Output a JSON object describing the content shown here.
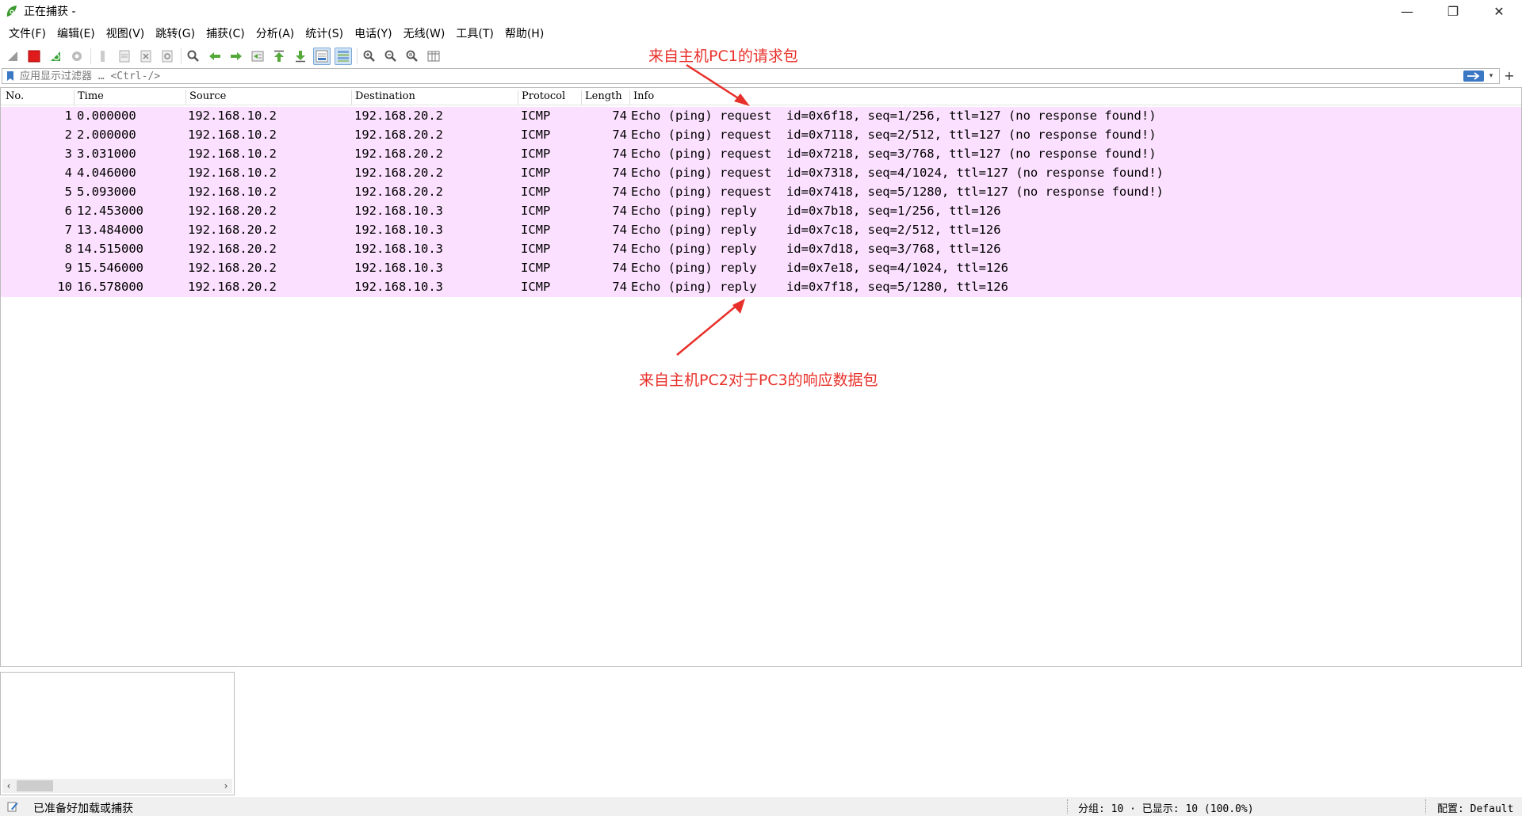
{
  "window": {
    "title": "正在捕获 -",
    "minimize": "—",
    "restore": "❐",
    "close": "✕"
  },
  "menu": [
    "文件(F)",
    "编辑(E)",
    "视图(V)",
    "跳转(G)",
    "捕获(C)",
    "分析(A)",
    "统计(S)",
    "电话(Y)",
    "无线(W)",
    "工具(T)",
    "帮助(H)"
  ],
  "toolbar": {
    "icons": [
      "start-capture-icon",
      "stop-capture-icon",
      "restart-capture-icon",
      "capture-options-icon",
      "open-file-icon",
      "save-file-icon",
      "close-file-icon",
      "reload-file-icon",
      "find-packet-icon",
      "go-back-icon",
      "go-forward-icon",
      "go-to-packet-icon",
      "go-first-icon",
      "go-last-icon",
      "auto-scroll-icon",
      "colorize-icon",
      "zoom-in-icon",
      "zoom-out-icon",
      "zoom-normal-icon",
      "resize-columns-icon"
    ]
  },
  "filter": {
    "placeholder": "应用显示过滤器 … <Ctrl-/>",
    "add_label": "+"
  },
  "columns": [
    "No.",
    "Time",
    "Source",
    "Destination",
    "Protocol",
    "Length",
    "Info"
  ],
  "packets": [
    {
      "no": "1",
      "time": "0.000000",
      "source": "192.168.10.2",
      "destination": "192.168.20.2",
      "protocol": "ICMP",
      "length": "74",
      "info": "Echo (ping) request  id=0x6f18, seq=1/256, ttl=127 (no response found!)"
    },
    {
      "no": "2",
      "time": "2.000000",
      "source": "192.168.10.2",
      "destination": "192.168.20.2",
      "protocol": "ICMP",
      "length": "74",
      "info": "Echo (ping) request  id=0x7118, seq=2/512, ttl=127 (no response found!)"
    },
    {
      "no": "3",
      "time": "3.031000",
      "source": "192.168.10.2",
      "destination": "192.168.20.2",
      "protocol": "ICMP",
      "length": "74",
      "info": "Echo (ping) request  id=0x7218, seq=3/768, ttl=127 (no response found!)"
    },
    {
      "no": "4",
      "time": "4.046000",
      "source": "192.168.10.2",
      "destination": "192.168.20.2",
      "protocol": "ICMP",
      "length": "74",
      "info": "Echo (ping) request  id=0x7318, seq=4/1024, ttl=127 (no response found!)"
    },
    {
      "no": "5",
      "time": "5.093000",
      "source": "192.168.10.2",
      "destination": "192.168.20.2",
      "protocol": "ICMP",
      "length": "74",
      "info": "Echo (ping) request  id=0x7418, seq=5/1280, ttl=127 (no response found!)"
    },
    {
      "no": "6",
      "time": "12.453000",
      "source": "192.168.20.2",
      "destination": "192.168.10.3",
      "protocol": "ICMP",
      "length": "74",
      "info": "Echo (ping) reply    id=0x7b18, seq=1/256, ttl=126"
    },
    {
      "no": "7",
      "time": "13.484000",
      "source": "192.168.20.2",
      "destination": "192.168.10.3",
      "protocol": "ICMP",
      "length": "74",
      "info": "Echo (ping) reply    id=0x7c18, seq=2/512, ttl=126"
    },
    {
      "no": "8",
      "time": "14.515000",
      "source": "192.168.20.2",
      "destination": "192.168.10.3",
      "protocol": "ICMP",
      "length": "74",
      "info": "Echo (ping) reply    id=0x7d18, seq=3/768, ttl=126"
    },
    {
      "no": "9",
      "time": "15.546000",
      "source": "192.168.20.2",
      "destination": "192.168.10.3",
      "protocol": "ICMP",
      "length": "74",
      "info": "Echo (ping) reply    id=0x7e18, seq=4/1024, ttl=126"
    },
    {
      "no": "10",
      "time": "16.578000",
      "source": "192.168.20.2",
      "destination": "192.168.10.3",
      "protocol": "ICMP",
      "length": "74",
      "info": "Echo (ping) reply    id=0x7f18, seq=5/1280, ttl=126"
    }
  ],
  "annotations": {
    "request_label": "来自主机PC1的请求包",
    "reply_label": "来自主机PC2对于PC3的响应数据包",
    "color": "#e8302a"
  },
  "row_color": "#fce0ff",
  "status": {
    "ready_text": "已准备好加载或捕获",
    "packets_text": "分组: 10 · 已显示: 10 (100.0%)",
    "profile_text": "配置: Default"
  }
}
